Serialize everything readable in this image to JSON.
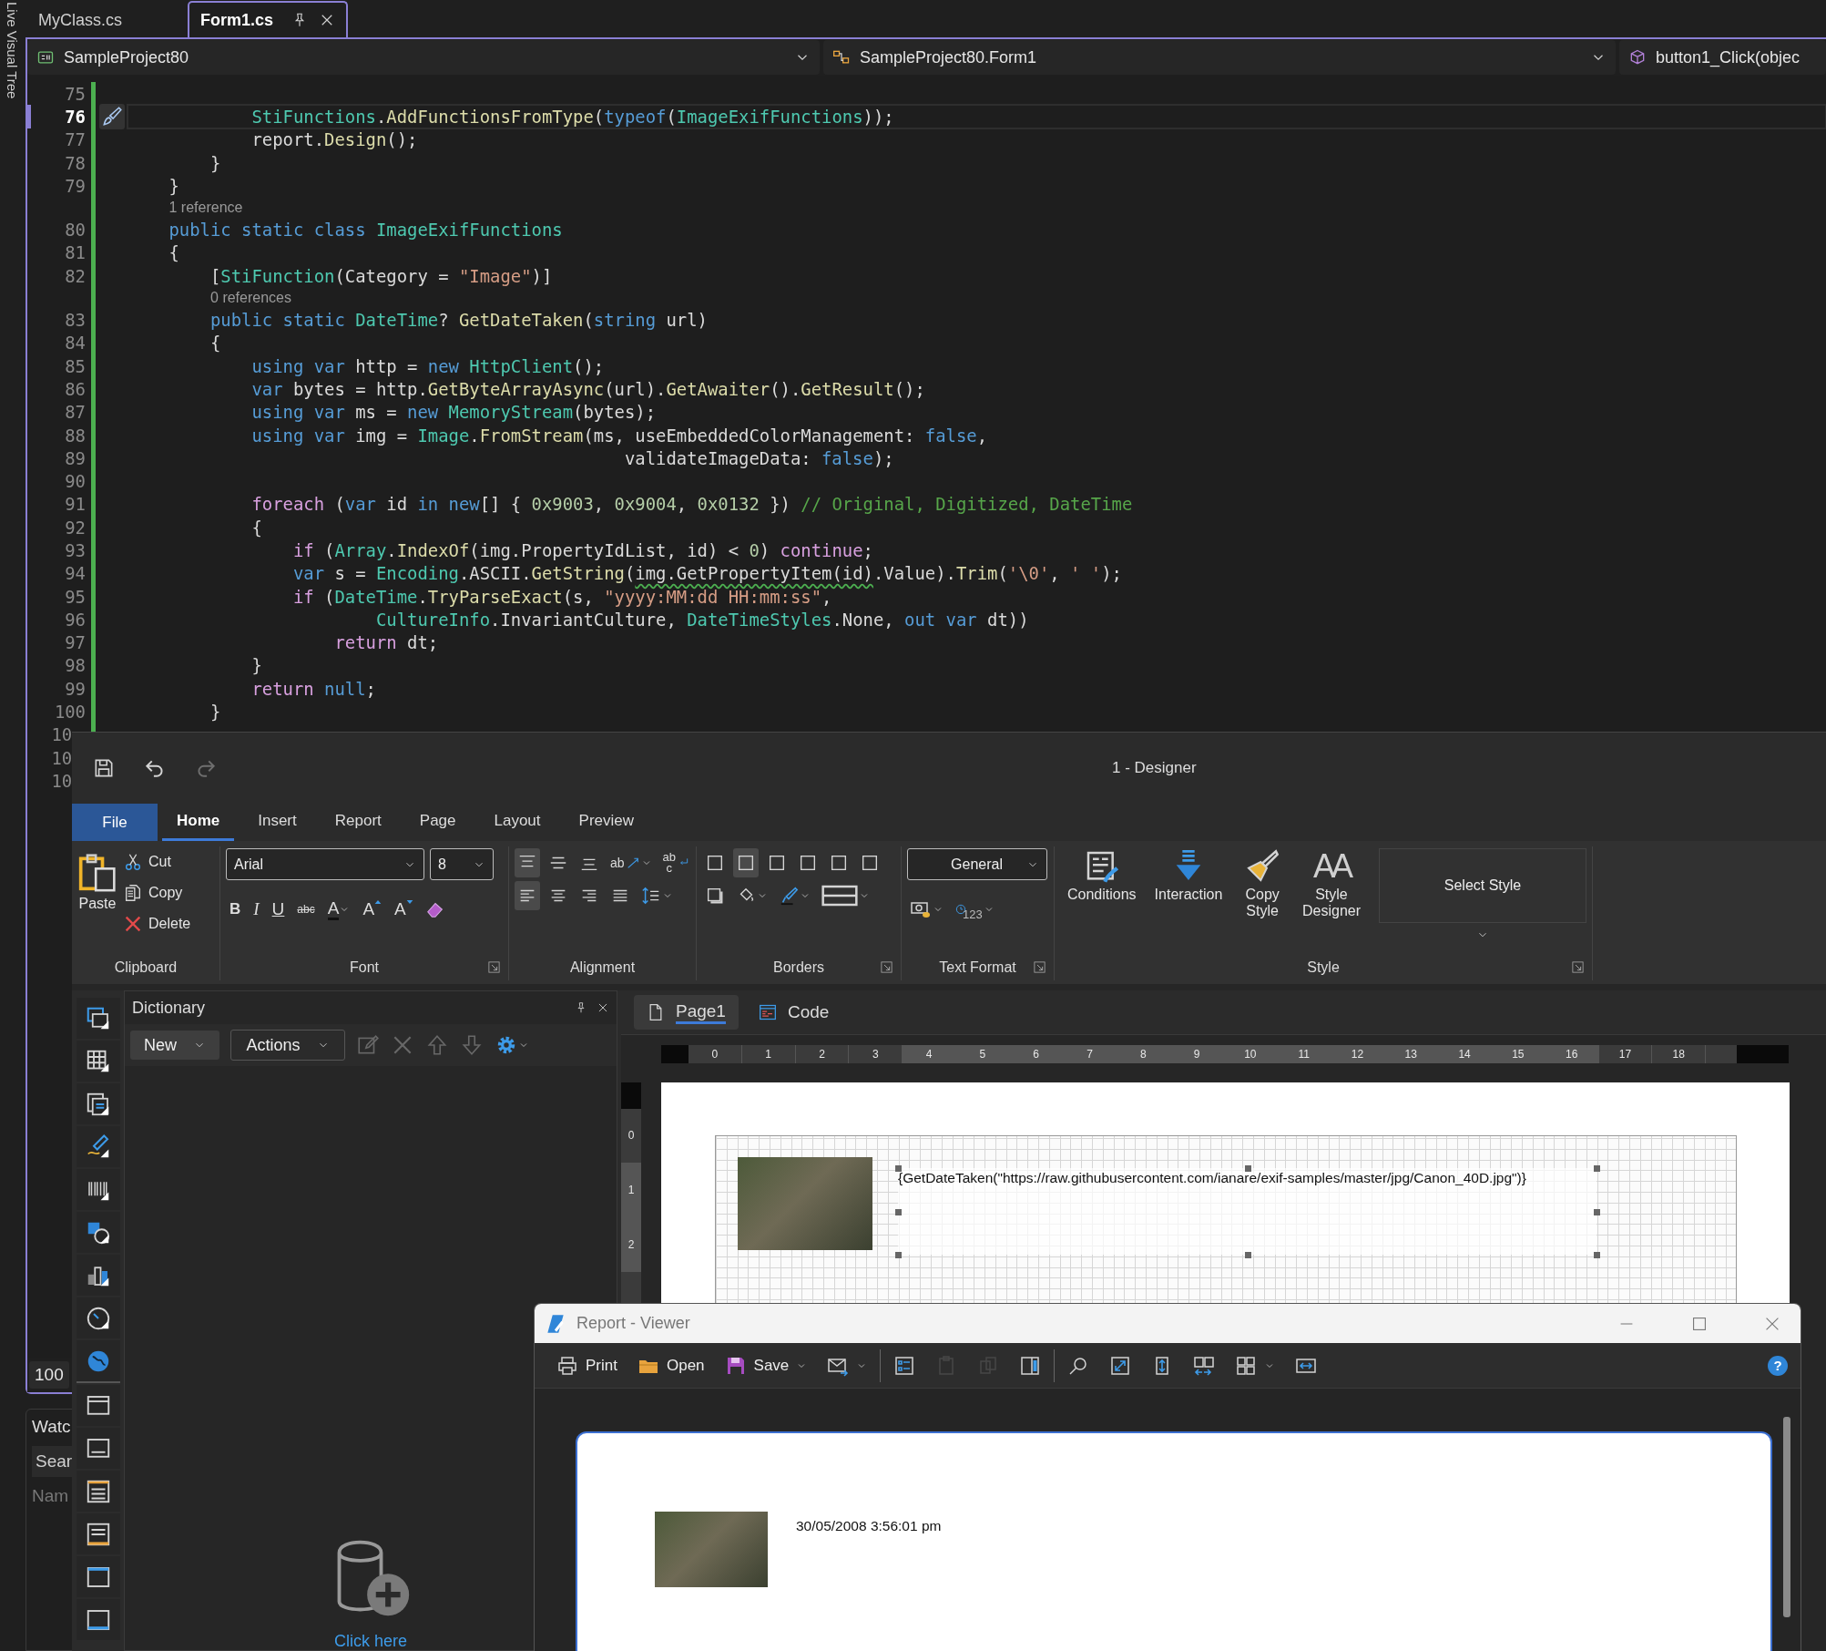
{
  "side_strip": {
    "title": "Live Visual Tree"
  },
  "editor_tabs": [
    {
      "label": "MyClass.cs",
      "selected": false
    },
    {
      "label": "Form1.cs",
      "selected": true
    }
  ],
  "nav_bar": {
    "project": "SampleProject80",
    "type": "SampleProject80.Form1",
    "member": "button1_Click(objec"
  },
  "code": {
    "lines": [
      {
        "kind": "code",
        "number": "75",
        "current": false,
        "cut": false
      },
      {
        "kind": "code",
        "number": "76",
        "current": true,
        "cut": false,
        "tokens": [
          {
            "kind": "type",
            "text": "            StiFunctions"
          },
          {
            "kind": "plain",
            "text": "."
          },
          {
            "kind": "method",
            "text": "AddFunctionsFromType"
          },
          {
            "kind": "plain",
            "text": "("
          },
          {
            "kind": "keyword",
            "text": "typeof"
          },
          {
            "kind": "plain",
            "text": "("
          },
          {
            "kind": "type",
            "text": "ImageExifFunctions"
          },
          {
            "kind": "plain",
            "text": "));"
          }
        ]
      },
      {
        "kind": "code",
        "number": "77",
        "current": false,
        "cut": false,
        "tokens": [
          {
            "kind": "plain",
            "text": "            report."
          },
          {
            "kind": "method",
            "text": "Design"
          },
          {
            "kind": "plain",
            "text": "();"
          }
        ]
      },
      {
        "kind": "code",
        "number": "78",
        "current": false,
        "cut": false,
        "tokens": [
          {
            "kind": "plain",
            "text": "        }"
          }
        ]
      },
      {
        "kind": "code",
        "number": "79",
        "current": false,
        "cut": false,
        "tokens": [
          {
            "kind": "plain",
            "text": "    }"
          }
        ]
      },
      {
        "kind": "codelens",
        "text": "1 reference"
      },
      {
        "kind": "code",
        "number": "80",
        "current": false,
        "cut": false,
        "tokens": [
          {
            "kind": "keyword",
            "text": "    public static class "
          },
          {
            "kind": "type",
            "text": "ImageExifFunctions"
          }
        ]
      },
      {
        "kind": "code",
        "number": "81",
        "current": false,
        "cut": false,
        "tokens": [
          {
            "kind": "plain",
            "text": "    {"
          }
        ]
      },
      {
        "kind": "code",
        "number": "82",
        "current": false,
        "cut": false,
        "tokens": [
          {
            "kind": "plain",
            "text": "        ["
          },
          {
            "kind": "type",
            "text": "StiFunction"
          },
          {
            "kind": "plain",
            "text": "(Category = "
          },
          {
            "kind": "string",
            "text": "\"Image\""
          },
          {
            "kind": "plain",
            "text": ")]"
          }
        ]
      },
      {
        "kind": "codelens",
        "text": "0 references"
      },
      {
        "kind": "code",
        "number": "83",
        "current": false,
        "cut": false,
        "tokens": [
          {
            "kind": "keyword",
            "text": "        public static "
          },
          {
            "kind": "type",
            "text": "DateTime"
          },
          {
            "kind": "plain",
            "text": "? "
          },
          {
            "kind": "method",
            "text": "GetDateTaken"
          },
          {
            "kind": "plain",
            "text": "("
          },
          {
            "kind": "keyword",
            "text": "string"
          },
          {
            "kind": "plain",
            "text": " url)"
          }
        ]
      },
      {
        "kind": "code",
        "number": "84",
        "current": false,
        "cut": false,
        "tokens": [
          {
            "kind": "plain",
            "text": "        {"
          }
        ]
      },
      {
        "kind": "code",
        "number": "85",
        "current": false,
        "cut": false,
        "tokens": [
          {
            "kind": "keyword",
            "text": "            using var"
          },
          {
            "kind": "plain",
            "text": " http = "
          },
          {
            "kind": "keyword",
            "text": "new "
          },
          {
            "kind": "type",
            "text": "HttpClient"
          },
          {
            "kind": "plain",
            "text": "();"
          }
        ]
      },
      {
        "kind": "code",
        "number": "86",
        "current": false,
        "cut": false,
        "tokens": [
          {
            "kind": "keyword",
            "text": "            var"
          },
          {
            "kind": "plain",
            "text": " bytes = http."
          },
          {
            "kind": "method",
            "text": "GetByteArrayAsync"
          },
          {
            "kind": "plain",
            "text": "(url)."
          },
          {
            "kind": "method",
            "text": "GetAwaiter"
          },
          {
            "kind": "plain",
            "text": "()."
          },
          {
            "kind": "method",
            "text": "GetResult"
          },
          {
            "kind": "plain",
            "text": "();"
          }
        ]
      },
      {
        "kind": "code",
        "number": "87",
        "current": false,
        "cut": false,
        "tokens": [
          {
            "kind": "keyword",
            "text": "            using var"
          },
          {
            "kind": "plain",
            "text": " ms = "
          },
          {
            "kind": "keyword",
            "text": "new "
          },
          {
            "kind": "type",
            "text": "MemoryStream"
          },
          {
            "kind": "plain",
            "text": "(bytes);"
          }
        ]
      },
      {
        "kind": "code",
        "number": "88",
        "current": false,
        "cut": false,
        "tokens": [
          {
            "kind": "keyword",
            "text": "            using var"
          },
          {
            "kind": "plain",
            "text": " img = "
          },
          {
            "kind": "type",
            "text": "Image"
          },
          {
            "kind": "plain",
            "text": "."
          },
          {
            "kind": "method",
            "text": "FromStream"
          },
          {
            "kind": "plain",
            "text": "(ms, useEmbeddedColorManagement: "
          },
          {
            "kind": "keyword",
            "text": "false"
          },
          {
            "kind": "plain",
            "text": ","
          }
        ]
      },
      {
        "kind": "code",
        "number": "89",
        "current": false,
        "cut": false,
        "tokens": [
          {
            "kind": "plain",
            "text": "                                                validateImageData: "
          },
          {
            "kind": "keyword",
            "text": "false"
          },
          {
            "kind": "plain",
            "text": ");"
          }
        ]
      },
      {
        "kind": "code",
        "number": "90",
        "current": false,
        "cut": false
      },
      {
        "kind": "code",
        "number": "91",
        "current": false,
        "cut": false,
        "tokens": [
          {
            "kind": "control",
            "text": "            foreach"
          },
          {
            "kind": "plain",
            "text": " ("
          },
          {
            "kind": "keyword",
            "text": "var"
          },
          {
            "kind": "plain",
            "text": " id "
          },
          {
            "kind": "keyword",
            "text": "in new"
          },
          {
            "kind": "plain",
            "text": "[] { "
          },
          {
            "kind": "number",
            "text": "0x9003"
          },
          {
            "kind": "plain",
            "text": ", "
          },
          {
            "kind": "number",
            "text": "0x9004"
          },
          {
            "kind": "plain",
            "text": ", "
          },
          {
            "kind": "number",
            "text": "0x0132"
          },
          {
            "kind": "plain",
            "text": " }) "
          },
          {
            "kind": "comment",
            "text": "// Original, Digitized, DateTime"
          }
        ]
      },
      {
        "kind": "code",
        "number": "92",
        "current": false,
        "cut": false,
        "tokens": [
          {
            "kind": "plain",
            "text": "            {"
          }
        ]
      },
      {
        "kind": "code",
        "number": "93",
        "current": false,
        "cut": false,
        "tokens": [
          {
            "kind": "control",
            "text": "                if"
          },
          {
            "kind": "plain",
            "text": " ("
          },
          {
            "kind": "type",
            "text": "Array"
          },
          {
            "kind": "plain",
            "text": "."
          },
          {
            "kind": "method",
            "text": "IndexOf"
          },
          {
            "kind": "plain",
            "text": "(img.PropertyIdList, id) < "
          },
          {
            "kind": "number",
            "text": "0"
          },
          {
            "kind": "plain",
            "text": ") "
          },
          {
            "kind": "control",
            "text": "continue"
          },
          {
            "kind": "plain",
            "text": ";"
          }
        ]
      },
      {
        "kind": "code",
        "number": "94",
        "current": false,
        "cut": false,
        "tokens": [
          {
            "kind": "keyword",
            "text": "                var"
          },
          {
            "kind": "plain",
            "text": " s = "
          },
          {
            "kind": "type",
            "text": "Encoding"
          },
          {
            "kind": "plain",
            "text": ".ASCII."
          },
          {
            "kind": "method",
            "text": "GetString"
          },
          {
            "kind": "plain",
            "text": "("
          },
          {
            "kind": "warning",
            "text": "img.GetPropertyItem(id)"
          },
          {
            "kind": "plain",
            "text": ".Value)."
          },
          {
            "kind": "method",
            "text": "Trim"
          },
          {
            "kind": "plain",
            "text": "("
          },
          {
            "kind": "string",
            "text": "'\\0'"
          },
          {
            "kind": "plain",
            "text": ", "
          },
          {
            "kind": "string",
            "text": "' '"
          },
          {
            "kind": "plain",
            "text": ");"
          }
        ]
      },
      {
        "kind": "code",
        "number": "95",
        "current": false,
        "cut": false,
        "tokens": [
          {
            "kind": "control",
            "text": "                if"
          },
          {
            "kind": "plain",
            "text": " ("
          },
          {
            "kind": "type",
            "text": "DateTime"
          },
          {
            "kind": "plain",
            "text": "."
          },
          {
            "kind": "method",
            "text": "TryParseExact"
          },
          {
            "kind": "plain",
            "text": "(s, "
          },
          {
            "kind": "string",
            "text": "\"yyyy:MM:dd HH:mm:ss\""
          },
          {
            "kind": "plain",
            "text": ","
          }
        ]
      },
      {
        "kind": "code",
        "number": "96",
        "current": false,
        "cut": false,
        "tokens": [
          {
            "kind": "type",
            "text": "                        CultureInfo"
          },
          {
            "kind": "plain",
            "text": ".InvariantCulture, "
          },
          {
            "kind": "type",
            "text": "DateTimeStyles"
          },
          {
            "kind": "plain",
            "text": ".None, "
          },
          {
            "kind": "keyword",
            "text": "out var"
          },
          {
            "kind": "plain",
            "text": " dt))"
          }
        ]
      },
      {
        "kind": "code",
        "number": "97",
        "current": false,
        "cut": false,
        "tokens": [
          {
            "kind": "control",
            "text": "                    return"
          },
          {
            "kind": "plain",
            "text": " dt;"
          }
        ]
      },
      {
        "kind": "code",
        "number": "98",
        "current": false,
        "cut": false,
        "tokens": [
          {
            "kind": "plain",
            "text": "            }"
          }
        ]
      },
      {
        "kind": "code",
        "number": "99",
        "current": false,
        "cut": false,
        "tokens": [
          {
            "kind": "control",
            "text": "            return"
          },
          {
            "kind": "keyword",
            "text": " null"
          },
          {
            "kind": "plain",
            "text": ";"
          }
        ]
      },
      {
        "kind": "code",
        "number": "100",
        "current": false,
        "cut": false,
        "tokens": [
          {
            "kind": "plain",
            "text": "        }"
          }
        ]
      },
      {
        "kind": "code",
        "number": "10",
        "current": false,
        "cut": true
      },
      {
        "kind": "code",
        "number": "10",
        "current": false,
        "cut": true
      },
      {
        "kind": "code",
        "number": "10",
        "current": false,
        "cut": true
      }
    ]
  },
  "bottom_panels": {
    "zoom": "100",
    "watch_title": "Watc",
    "search_placeholder": "Sear",
    "column": "Nam"
  },
  "designer": {
    "title": "1 - Designer",
    "quick_access": [
      {
        "disabled": false
      },
      {
        "disabled": false
      },
      {
        "disabled": true
      }
    ],
    "file_tab": "File",
    "tabs": [
      {
        "label": "Home",
        "selected": true
      },
      {
        "label": "Insert",
        "selected": false
      },
      {
        "label": "Report",
        "selected": false
      },
      {
        "label": "Page",
        "selected": false
      },
      {
        "label": "Layout",
        "selected": false
      },
      {
        "label": "Preview",
        "selected": false
      }
    ],
    "clipboard": {
      "label": "Clipboard",
      "launcher": false,
      "paste": "Paste",
      "items": [
        {
          "label": "Cut"
        },
        {
          "label": "Copy"
        },
        {
          "label": "Delete"
        }
      ]
    },
    "font": {
      "label": "Font",
      "launcher": true,
      "family": "Arial",
      "size": "8",
      "buttons": [
        {
          "kind": "bold",
          "label": "B"
        },
        {
          "kind": "italic",
          "label": "I"
        },
        {
          "kind": "underline",
          "label": "U"
        },
        {
          "kind": "strike",
          "label": "abc"
        },
        {
          "kind": "color",
          "label": "A"
        },
        {
          "kind": "grow",
          "label": "A"
        },
        {
          "kind": "shrink",
          "label": "A"
        }
      ]
    },
    "alignment": {
      "label": "Alignment",
      "launcher": false,
      "vertical": [
        {
          "selected": true
        },
        {
          "selected": false
        },
        {
          "selected": false
        }
      ],
      "rotation": "ab",
      "wrap": "abc",
      "horizontal": [
        {
          "selected": true
        },
        {
          "selected": false
        },
        {
          "selected": false
        },
        {
          "selected": false
        }
      ]
    },
    "borders": {
      "label": "Borders",
      "launcher": true,
      "sides": [
        {
          "selected": false
        },
        {
          "selected": true
        },
        {
          "selected": false
        },
        {
          "selected": false
        },
        {
          "selected": false
        },
        {
          "selected": false
        }
      ]
    },
    "text_format": {
      "label": "Text Format",
      "launcher": true,
      "format": "General",
      "date_glyph": "123"
    },
    "style": {
      "label": "Style",
      "launcher": true,
      "buttons": [
        {
          "kind": "conditions",
          "label": "Conditions"
        },
        {
          "kind": "interaction",
          "label": "Interaction"
        },
        {
          "kind": "copy",
          "label": "Copy Style"
        },
        {
          "kind": "designer",
          "label": "Style Designer",
          "glyph": "AA"
        }
      ],
      "gallery": "Select Style"
    },
    "dictionary": {
      "title": "Dictionary",
      "new_button": "New",
      "actions_button": "Actions",
      "tools": [
        {
          "disabled": true
        },
        {
          "disabled": true
        },
        {
          "disabled": true
        },
        {
          "disabled": true
        },
        {
          "disabled": false
        }
      ],
      "empty_link": "Click here"
    },
    "surface": {
      "tabs": [
        {
          "kind": "page",
          "label": "Page1",
          "selected": true
        },
        {
          "kind": "code",
          "label": "Code",
          "selected": false
        }
      ],
      "ruler": [
        {
          "label": "0",
          "highlighted": false
        },
        {
          "label": "1",
          "highlighted": false
        },
        {
          "label": "2",
          "highlighted": false
        },
        {
          "label": "3",
          "highlighted": false
        },
        {
          "label": "4",
          "highlighted": true
        },
        {
          "label": "5",
          "highlighted": true
        },
        {
          "label": "6",
          "highlighted": true
        },
        {
          "label": "7",
          "highlighted": true
        },
        {
          "label": "8",
          "highlighted": true
        },
        {
          "label": "9",
          "highlighted": true
        },
        {
          "label": "10",
          "highlighted": true
        },
        {
          "label": "11",
          "highlighted": true
        },
        {
          "label": "12",
          "highlighted": true
        },
        {
          "label": "13",
          "highlighted": true
        },
        {
          "label": "14",
          "highlighted": true
        },
        {
          "label": "15",
          "highlighted": true
        },
        {
          "label": "16",
          "highlighted": true
        },
        {
          "label": "17",
          "highlighted": false
        },
        {
          "label": "18",
          "highlighted": false
        }
      ],
      "vertical_ruler": [
        {
          "label": "0",
          "highlighted": false
        },
        {
          "label": "1",
          "highlighted": true
        },
        {
          "label": "2",
          "highlighted": true
        }
      ],
      "text_component": "{GetDateTaken(\"https://raw.githubusercontent.com/ianare/exif-samples/master/jpg/Canon_40D.jpg\")}"
    }
  },
  "viewer": {
    "title": "Report - Viewer",
    "tool_groups": [
      {
        "items": [
          {
            "kind": "print",
            "label": "Print",
            "disabled": false,
            "dropdown": false
          },
          {
            "kind": "open",
            "label": "Open",
            "disabled": false,
            "dropdown": false
          },
          {
            "kind": "save",
            "label": "Save",
            "disabled": false,
            "dropdown": true
          },
          {
            "kind": "email",
            "disabled": false,
            "dropdown": true
          }
        ]
      },
      {
        "items": [
          {
            "kind": "bookmarks",
            "disabled": false,
            "dropdown": false
          },
          {
            "kind": "parameters",
            "disabled": true,
            "dropdown": false
          },
          {
            "kind": "thumbnails",
            "disabled": true,
            "dropdown": false
          },
          {
            "kind": "panel",
            "disabled": false,
            "dropdown": false
          }
        ]
      },
      {
        "items": [
          {
            "kind": "find",
            "disabled": false,
            "dropdown": false
          },
          {
            "kind": "fullscreen",
            "disabled": false,
            "dropdown": false
          },
          {
            "kind": "page_height",
            "disabled": false,
            "dropdown": false
          },
          {
            "kind": "two_pages",
            "disabled": false,
            "dropdown": false
          },
          {
            "kind": "multiple_pages",
            "disabled": false,
            "dropdown": true
          },
          {
            "kind": "page_width",
            "disabled": false,
            "dropdown": false
          }
        ]
      }
    ],
    "help": "?",
    "report_text": "30/05/2008 3:56:01 pm"
  }
}
